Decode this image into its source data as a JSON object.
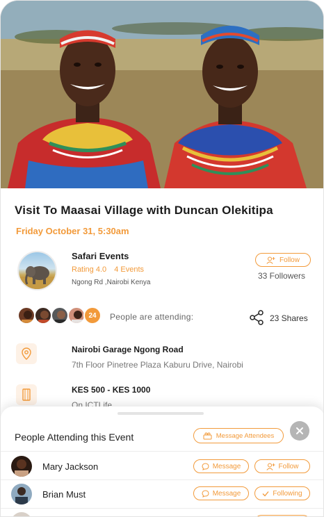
{
  "event": {
    "title": "Visit To Maasai Village with Duncan Olekitipa",
    "date": "Friday October 31, 5:30am"
  },
  "organizer": {
    "name": "Safari Events",
    "rating": "Rating 4.0",
    "events": "4 Events",
    "address": "Ngong Rd ,Nairobi Kenya",
    "follow_label": "Follow",
    "followers": "33 Followers"
  },
  "attendance": {
    "count_badge": "24",
    "label": "People are attending:",
    "shares": "23 Shares"
  },
  "location": {
    "title": "Nairobi Garage Ngong Road",
    "subtitle": "7th Floor Pinetree Plaza Kaburu Drive, Nairobi"
  },
  "ticket": {
    "title": "KES 500 - KES 1000",
    "subtitle": "On ICTLife"
  },
  "sheet": {
    "title": "People Attending this Event",
    "message_attendees_label": "Message Attendees",
    "people": [
      {
        "name": "Mary Jackson",
        "message_label": "Message",
        "follow_label": "Follow"
      },
      {
        "name": "Brian Must",
        "message_label": "Message",
        "follow_label": "Following"
      }
    ]
  },
  "colors": {
    "accent": "#f29a3a",
    "accent_light": "#fdf1e6"
  },
  "icons": [
    "location-pin-icon",
    "ticket-icon",
    "share-icon",
    "add-user-icon",
    "chat-bubble-icon",
    "checkmark-icon",
    "close-icon",
    "group-icon"
  ]
}
